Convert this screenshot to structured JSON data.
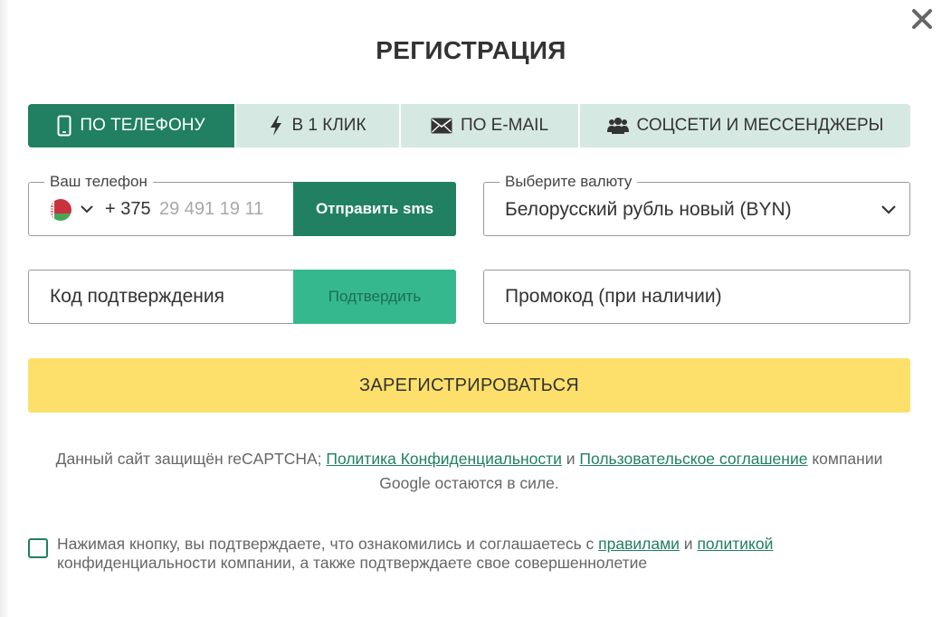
{
  "modal": {
    "title": "РЕГИСТРАЦИЯ",
    "close_icon": "close-icon"
  },
  "tabs": [
    {
      "label": "ПО ТЕЛЕФОНУ",
      "icon": "phone-icon",
      "active": true
    },
    {
      "label": "В 1 КЛИК",
      "icon": "lightning-icon",
      "active": false
    },
    {
      "label": "ПО E-MAIL",
      "icon": "envelope-icon",
      "active": false
    },
    {
      "label": "СОЦСЕТИ И МЕССЕНДЖЕРЫ",
      "icon": "users-icon",
      "active": false
    }
  ],
  "phone": {
    "label": "Ваш телефон",
    "country_flag": "belarus-flag-icon",
    "code": "+ 375",
    "placeholder": "29 491 19 11",
    "send_sms_label": "Отправить sms"
  },
  "currency": {
    "label": "Выберите валюту",
    "selected": "Белорусский рубль новый (BYN)"
  },
  "confirm": {
    "placeholder": "Код подтверждения",
    "button_label": "Подтвердить"
  },
  "promo": {
    "placeholder": "Промокод (при наличии)"
  },
  "register_label": "ЗАРЕГИСТРИРОВАТЬСЯ",
  "recaptcha": {
    "text_before": "Данный сайт защищён reCAPTCHA; ",
    "privacy_link": "Политика Конфиденциальности",
    "and": " и ",
    "terms_link": "Пользовательское соглашение",
    "text_after": " компании Google остаются в силе."
  },
  "agreement": {
    "text_before": "Нажимая кнопку, вы подтверждаете, что ознакомились и соглашаетесь с ",
    "rules_link": "правилами",
    "and": " и ",
    "policy_link": "политикой",
    "text_after": " конфиденциальности компании, а также подтверждаете свое совершеннолетие",
    "checked": false
  },
  "colors": {
    "primary_green": "#208061",
    "light_green": "#35b88d",
    "tab_bg": "#d6e8e2",
    "register_yellow": "#fde06b"
  }
}
